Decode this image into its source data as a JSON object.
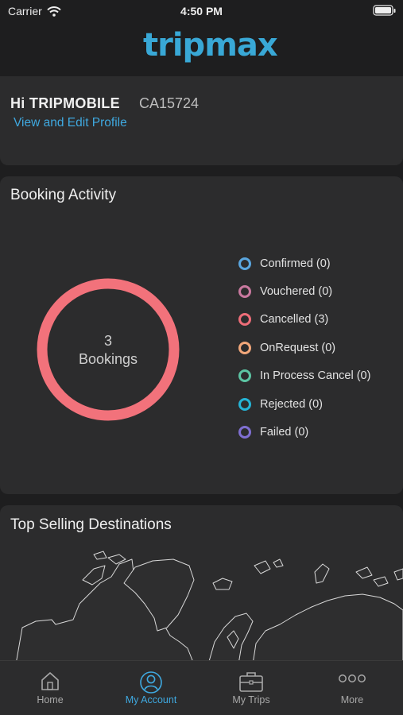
{
  "status_bar": {
    "carrier": "Carrier",
    "time": "4:50 PM"
  },
  "header": {
    "logo_text": "tripmax"
  },
  "profile": {
    "greeting": "Hi TRIPMOBILE",
    "agent_code": "CA15724",
    "edit_link": "View and Edit Profile"
  },
  "booking_activity": {
    "title": "Booking Activity",
    "total_count": "3",
    "total_label": "Bookings",
    "donut_color": "#f2727b",
    "legend": [
      {
        "label": "Confirmed (0)",
        "color": "#5aa6df"
      },
      {
        "label": "Vouchered (0)",
        "color": "#c9799f"
      },
      {
        "label": "Cancelled (3)",
        "color": "#ee6d78"
      },
      {
        "label": "OnRequest (0)",
        "color": "#f2a77a"
      },
      {
        "label": "In Process Cancel (0)",
        "color": "#5cc4a3"
      },
      {
        "label": "Rejected (0)",
        "color": "#25b4d6"
      },
      {
        "label": "Failed (0)",
        "color": "#7f6fd1"
      }
    ]
  },
  "destinations": {
    "title": "Top Selling Destinations"
  },
  "tabs": [
    {
      "label": "Home",
      "icon": "home-icon",
      "active": false
    },
    {
      "label": "My Account",
      "icon": "account-icon",
      "active": true
    },
    {
      "label": "My Trips",
      "icon": "briefcase-icon",
      "active": false
    },
    {
      "label": "More",
      "icon": "more-icon",
      "active": false
    }
  ],
  "colors": {
    "accent": "#3fa9e0",
    "background": "#1e1e1f",
    "card": "#2c2c2d"
  }
}
